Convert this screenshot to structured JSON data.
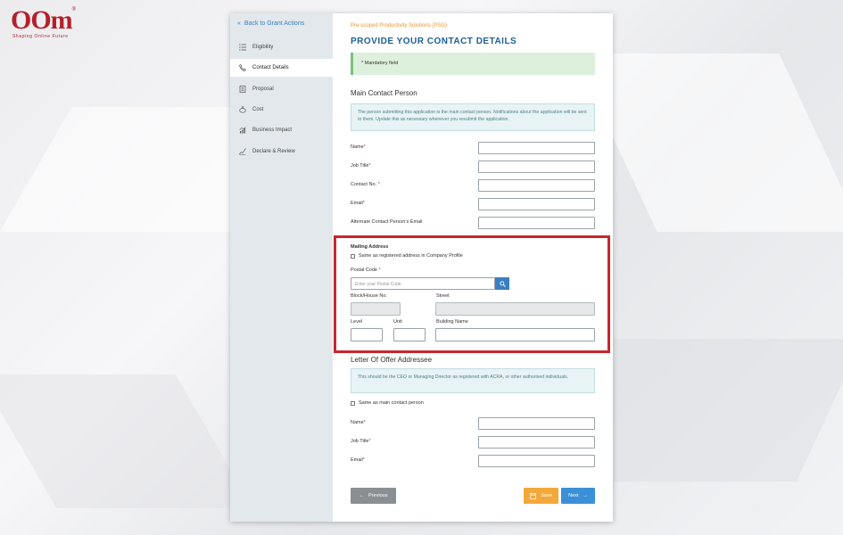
{
  "logo": {
    "text": "OOm",
    "tagline": "Shaping Online Future",
    "reg": "®"
  },
  "sidebar": {
    "back_label": "Back to Grant Actions",
    "items": [
      {
        "label": "Eligibility",
        "icon": "list-icon"
      },
      {
        "label": "Contact Details",
        "icon": "phone-icon",
        "active": true
      },
      {
        "label": "Proposal",
        "icon": "document-icon"
      },
      {
        "label": "Cost",
        "icon": "piggy-bank-icon"
      },
      {
        "label": "Business Impact",
        "icon": "chart-icon"
      },
      {
        "label": "Declare & Review",
        "icon": "signature-icon"
      }
    ]
  },
  "header": {
    "breadcrumb": "Pre-scoped Productivity Solutions (PSG)",
    "title": "PROVIDE YOUR CONTACT DETAILS"
  },
  "mandatory_note": "* Mandatory field",
  "main_contact": {
    "heading": "Main Contact Person",
    "info": "The person submitting this application is the main contact person. Notifications about the application will be sent to them. Update this as necessary whenever you resubmit the application.",
    "fields": {
      "name": "Name",
      "job_title": "Job Title",
      "contact_no": "Contact No.",
      "email": "Email",
      "alt_email": "Alternate Contact Person's Email"
    }
  },
  "mailing": {
    "heading": "Mailing Address",
    "same_as_registered": "Same as registered address in Company Profile",
    "postal_code_label": "Postal Code",
    "postal_code_placeholder": "Enter your Postal Code",
    "block_label": "Block/House No.",
    "street_label": "Street",
    "level_label": "Level",
    "unit_label": "Unit",
    "building_label": "Building Name"
  },
  "letter_of_offer": {
    "heading": "Letter Of Offer Addressee",
    "info": "This should be the CEO or Managing Director as registered with ACRA, or other authorised individuals.",
    "same_as_main": "Same as main contact person",
    "fields": {
      "name": "Name",
      "job_title": "Job Title",
      "email": "Email"
    }
  },
  "buttons": {
    "previous": "Previous",
    "save": "Save",
    "next": "Next"
  },
  "required_marker": "*",
  "colors": {
    "accent_blue": "#1c5f96",
    "link_blue": "#3a7fc1",
    "orange": "#f4a83a",
    "highlight_red": "#c8262e",
    "mandatory_bg": "#dcf0dc"
  }
}
